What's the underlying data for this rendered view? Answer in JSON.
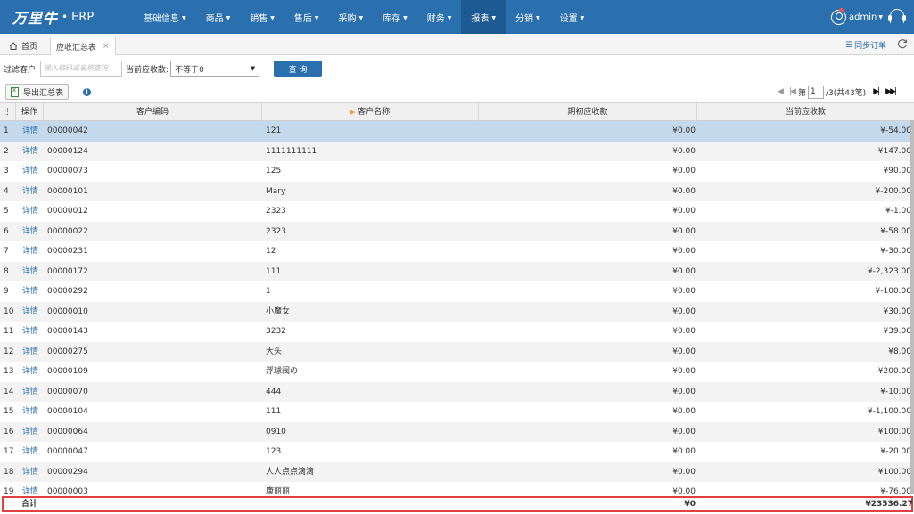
{
  "app": {
    "brand": "万里牛",
    "product": "ERP",
    "user": "admin"
  },
  "nav": [
    "基础信息",
    "商品",
    "销售",
    "售后",
    "采购",
    "库存",
    "财务",
    "报表",
    "分销",
    "设置"
  ],
  "nav_active": "报表",
  "tabs": {
    "home": "首页",
    "current": "应收汇总表",
    "close": "×"
  },
  "sync_order": "同步订单",
  "filter": {
    "customer_label": "过滤客户:",
    "customer_placeholder": "输入编码或名称查询",
    "current_ar_label": "当前应收款:",
    "current_ar_value": "不等于0",
    "search_label": "查 询"
  },
  "toolbar": {
    "export_label": "导出汇总表"
  },
  "pager": {
    "page_prefix": "第",
    "page": "1",
    "page_suffix": "/3(共43笔)"
  },
  "table": {
    "headers": {
      "op": "操作",
      "code": "客户编码",
      "name": "客户名称",
      "opening": "期初应收款",
      "current": "当前应收款"
    },
    "rows": [
      {
        "num": "1",
        "op": "详情",
        "code": "00000042",
        "name": "121",
        "opening": "¥0.00",
        "current": "¥-54.00"
      },
      {
        "num": "2",
        "op": "详情",
        "code": "00000124",
        "name": "1111111111",
        "opening": "¥0.00",
        "current": "¥147.00"
      },
      {
        "num": "3",
        "op": "详情",
        "code": "00000073",
        "name": "125",
        "opening": "¥0.00",
        "current": "¥90.00"
      },
      {
        "num": "4",
        "op": "详情",
        "code": "00000101",
        "name": "Mary",
        "opening": "¥0.00",
        "current": "¥-200.00"
      },
      {
        "num": "5",
        "op": "详情",
        "code": "00000012",
        "name": "2323",
        "opening": "¥0.00",
        "current": "¥-1.00"
      },
      {
        "num": "6",
        "op": "详情",
        "code": "00000022",
        "name": "2323",
        "opening": "¥0.00",
        "current": "¥-58.00"
      },
      {
        "num": "7",
        "op": "详情",
        "code": "00000231",
        "name": "12",
        "opening": "¥0.00",
        "current": "¥-30.00"
      },
      {
        "num": "8",
        "op": "详情",
        "code": "00000172",
        "name": "111",
        "opening": "¥0.00",
        "current": "¥-2,323.00"
      },
      {
        "num": "9",
        "op": "详情",
        "code": "00000292",
        "name": "1",
        "opening": "¥0.00",
        "current": "¥-100.00"
      },
      {
        "num": "10",
        "op": "详情",
        "code": "00000010",
        "name": "小魔女",
        "opening": "¥0.00",
        "current": "¥30.00"
      },
      {
        "num": "11",
        "op": "详情",
        "code": "00000143",
        "name": "3232",
        "opening": "¥0.00",
        "current": "¥39.00"
      },
      {
        "num": "12",
        "op": "详情",
        "code": "00000275",
        "name": "大头",
        "opening": "¥0.00",
        "current": "¥8.00"
      },
      {
        "num": "13",
        "op": "详情",
        "code": "00000109",
        "name": "浮球阀の",
        "opening": "¥0.00",
        "current": "¥200.00"
      },
      {
        "num": "14",
        "op": "详情",
        "code": "00000070",
        "name": "444",
        "opening": "¥0.00",
        "current": "¥-10.00"
      },
      {
        "num": "15",
        "op": "详情",
        "code": "00000104",
        "name": "111",
        "opening": "¥0.00",
        "current": "¥-1,100.00"
      },
      {
        "num": "16",
        "op": "详情",
        "code": "00000064",
        "name": "0910",
        "opening": "¥0.00",
        "current": "¥100.00"
      },
      {
        "num": "17",
        "op": "详情",
        "code": "00000047",
        "name": "123",
        "opening": "¥0.00",
        "current": "¥-20.00"
      },
      {
        "num": "18",
        "op": "详情",
        "code": "00000294",
        "name": "人人点点滴滴",
        "opening": "¥0.00",
        "current": "¥100.00"
      },
      {
        "num": "19",
        "op": "详情",
        "code": "00000003",
        "name": "康丽丽",
        "opening": "¥0.00",
        "current": "¥-76.00"
      }
    ],
    "selected_row": "1",
    "total": {
      "label": "合计",
      "opening": "¥0",
      "current": "¥23536.27"
    }
  },
  "colors": {
    "topbar": "#2a6fae",
    "selected_row": "#c5d9ec",
    "highlight_border": "#e14040",
    "link": "#2a6fae"
  }
}
